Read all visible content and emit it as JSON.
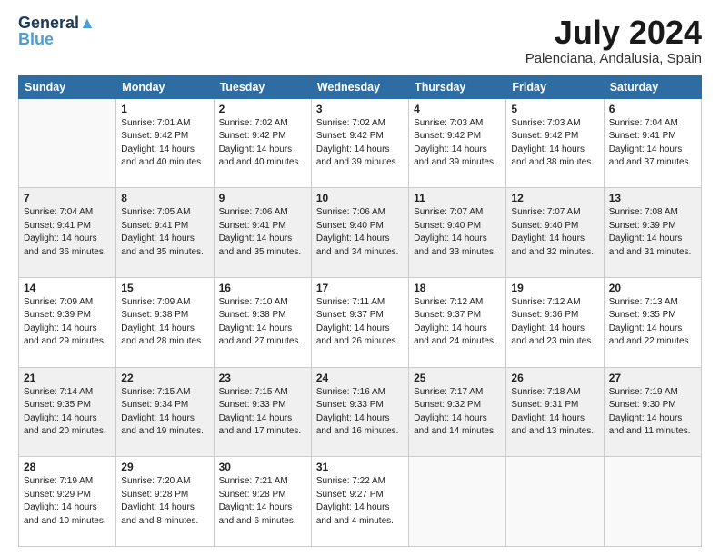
{
  "header": {
    "logo_line1": "General",
    "logo_line2": "Blue",
    "month_year": "July 2024",
    "location": "Palenciana, Andalusia, Spain"
  },
  "weekdays": [
    "Sunday",
    "Monday",
    "Tuesday",
    "Wednesday",
    "Thursday",
    "Friday",
    "Saturday"
  ],
  "weeks": [
    [
      {
        "day": "",
        "sunrise": "",
        "sunset": "",
        "daylight": "",
        "empty": true
      },
      {
        "day": "1",
        "sunrise": "Sunrise: 7:01 AM",
        "sunset": "Sunset: 9:42 PM",
        "daylight": "Daylight: 14 hours and 40 minutes."
      },
      {
        "day": "2",
        "sunrise": "Sunrise: 7:02 AM",
        "sunset": "Sunset: 9:42 PM",
        "daylight": "Daylight: 14 hours and 40 minutes."
      },
      {
        "day": "3",
        "sunrise": "Sunrise: 7:02 AM",
        "sunset": "Sunset: 9:42 PM",
        "daylight": "Daylight: 14 hours and 39 minutes."
      },
      {
        "day": "4",
        "sunrise": "Sunrise: 7:03 AM",
        "sunset": "Sunset: 9:42 PM",
        "daylight": "Daylight: 14 hours and 39 minutes."
      },
      {
        "day": "5",
        "sunrise": "Sunrise: 7:03 AM",
        "sunset": "Sunset: 9:42 PM",
        "daylight": "Daylight: 14 hours and 38 minutes."
      },
      {
        "day": "6",
        "sunrise": "Sunrise: 7:04 AM",
        "sunset": "Sunset: 9:41 PM",
        "daylight": "Daylight: 14 hours and 37 minutes."
      }
    ],
    [
      {
        "day": "7",
        "sunrise": "Sunrise: 7:04 AM",
        "sunset": "Sunset: 9:41 PM",
        "daylight": "Daylight: 14 hours and 36 minutes."
      },
      {
        "day": "8",
        "sunrise": "Sunrise: 7:05 AM",
        "sunset": "Sunset: 9:41 PM",
        "daylight": "Daylight: 14 hours and 35 minutes."
      },
      {
        "day": "9",
        "sunrise": "Sunrise: 7:06 AM",
        "sunset": "Sunset: 9:41 PM",
        "daylight": "Daylight: 14 hours and 35 minutes."
      },
      {
        "day": "10",
        "sunrise": "Sunrise: 7:06 AM",
        "sunset": "Sunset: 9:40 PM",
        "daylight": "Daylight: 14 hours and 34 minutes."
      },
      {
        "day": "11",
        "sunrise": "Sunrise: 7:07 AM",
        "sunset": "Sunset: 9:40 PM",
        "daylight": "Daylight: 14 hours and 33 minutes."
      },
      {
        "day": "12",
        "sunrise": "Sunrise: 7:07 AM",
        "sunset": "Sunset: 9:40 PM",
        "daylight": "Daylight: 14 hours and 32 minutes."
      },
      {
        "day": "13",
        "sunrise": "Sunrise: 7:08 AM",
        "sunset": "Sunset: 9:39 PM",
        "daylight": "Daylight: 14 hours and 31 minutes."
      }
    ],
    [
      {
        "day": "14",
        "sunrise": "Sunrise: 7:09 AM",
        "sunset": "Sunset: 9:39 PM",
        "daylight": "Daylight: 14 hours and 29 minutes."
      },
      {
        "day": "15",
        "sunrise": "Sunrise: 7:09 AM",
        "sunset": "Sunset: 9:38 PM",
        "daylight": "Daylight: 14 hours and 28 minutes."
      },
      {
        "day": "16",
        "sunrise": "Sunrise: 7:10 AM",
        "sunset": "Sunset: 9:38 PM",
        "daylight": "Daylight: 14 hours and 27 minutes."
      },
      {
        "day": "17",
        "sunrise": "Sunrise: 7:11 AM",
        "sunset": "Sunset: 9:37 PM",
        "daylight": "Daylight: 14 hours and 26 minutes."
      },
      {
        "day": "18",
        "sunrise": "Sunrise: 7:12 AM",
        "sunset": "Sunset: 9:37 PM",
        "daylight": "Daylight: 14 hours and 24 minutes."
      },
      {
        "day": "19",
        "sunrise": "Sunrise: 7:12 AM",
        "sunset": "Sunset: 9:36 PM",
        "daylight": "Daylight: 14 hours and 23 minutes."
      },
      {
        "day": "20",
        "sunrise": "Sunrise: 7:13 AM",
        "sunset": "Sunset: 9:35 PM",
        "daylight": "Daylight: 14 hours and 22 minutes."
      }
    ],
    [
      {
        "day": "21",
        "sunrise": "Sunrise: 7:14 AM",
        "sunset": "Sunset: 9:35 PM",
        "daylight": "Daylight: 14 hours and 20 minutes."
      },
      {
        "day": "22",
        "sunrise": "Sunrise: 7:15 AM",
        "sunset": "Sunset: 9:34 PM",
        "daylight": "Daylight: 14 hours and 19 minutes."
      },
      {
        "day": "23",
        "sunrise": "Sunrise: 7:15 AM",
        "sunset": "Sunset: 9:33 PM",
        "daylight": "Daylight: 14 hours and 17 minutes."
      },
      {
        "day": "24",
        "sunrise": "Sunrise: 7:16 AM",
        "sunset": "Sunset: 9:33 PM",
        "daylight": "Daylight: 14 hours and 16 minutes."
      },
      {
        "day": "25",
        "sunrise": "Sunrise: 7:17 AM",
        "sunset": "Sunset: 9:32 PM",
        "daylight": "Daylight: 14 hours and 14 minutes."
      },
      {
        "day": "26",
        "sunrise": "Sunrise: 7:18 AM",
        "sunset": "Sunset: 9:31 PM",
        "daylight": "Daylight: 14 hours and 13 minutes."
      },
      {
        "day": "27",
        "sunrise": "Sunrise: 7:19 AM",
        "sunset": "Sunset: 9:30 PM",
        "daylight": "Daylight: 14 hours and 11 minutes."
      }
    ],
    [
      {
        "day": "28",
        "sunrise": "Sunrise: 7:19 AM",
        "sunset": "Sunset: 9:29 PM",
        "daylight": "Daylight: 14 hours and 10 minutes."
      },
      {
        "day": "29",
        "sunrise": "Sunrise: 7:20 AM",
        "sunset": "Sunset: 9:28 PM",
        "daylight": "Daylight: 14 hours and 8 minutes."
      },
      {
        "day": "30",
        "sunrise": "Sunrise: 7:21 AM",
        "sunset": "Sunset: 9:28 PM",
        "daylight": "Daylight: 14 hours and 6 minutes."
      },
      {
        "day": "31",
        "sunrise": "Sunrise: 7:22 AM",
        "sunset": "Sunset: 9:27 PM",
        "daylight": "Daylight: 14 hours and 4 minutes."
      },
      {
        "day": "",
        "sunrise": "",
        "sunset": "",
        "daylight": "",
        "empty": true
      },
      {
        "day": "",
        "sunrise": "",
        "sunset": "",
        "daylight": "",
        "empty": true
      },
      {
        "day": "",
        "sunrise": "",
        "sunset": "",
        "daylight": "",
        "empty": true
      }
    ]
  ]
}
